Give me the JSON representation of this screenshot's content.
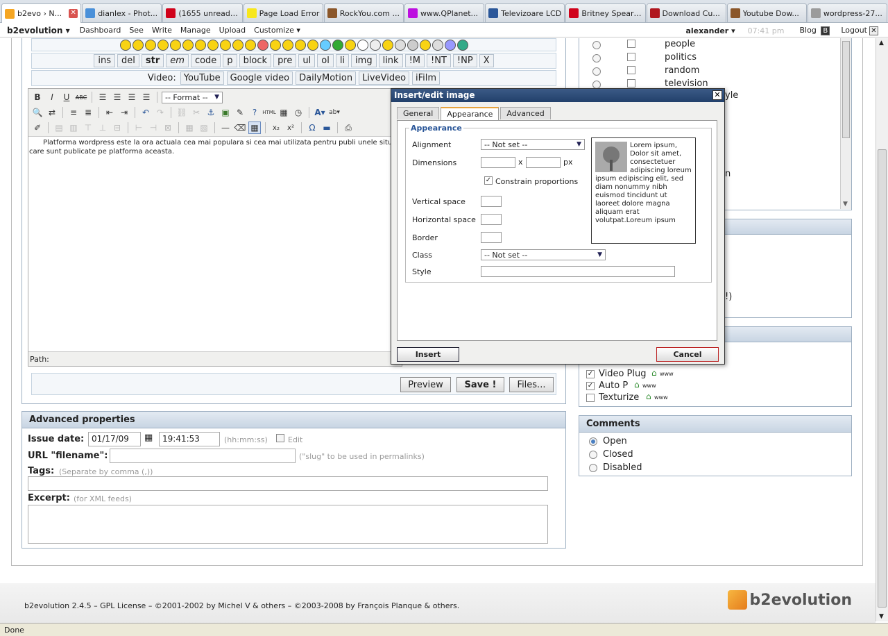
{
  "browser": {
    "tabs": [
      {
        "label": "b2evo › N...",
        "color": "#f5a623"
      },
      {
        "label": "dianlex - Phot...",
        "color": "#4a90d9"
      },
      {
        "label": "(1655 unread) ...",
        "color": "#d0021b"
      },
      {
        "label": "Page Load Error",
        "color": "#f8e71c"
      },
      {
        "label": "RockYou.com ...",
        "color": "#8b572a"
      },
      {
        "label": "www.QPlanet...",
        "color": "#bd10e0"
      },
      {
        "label": "Televizoare LCD",
        "color": "#2b5799"
      },
      {
        "label": "Britney Spears...",
        "color": "#d0021b"
      },
      {
        "label": "Download Cu...",
        "color": "#b0171f"
      },
      {
        "label": "Youtube Dow...",
        "color": "#8b572a"
      },
      {
        "label": "wordpress-27...",
        "color": "#9b9b9b"
      }
    ]
  },
  "topnav": {
    "brand": "b2evolution",
    "items": [
      "Dashboard",
      "See",
      "Write",
      "Manage",
      "Upload",
      "Customize"
    ],
    "user": "alexander",
    "time": "07:41 pm",
    "blog": "Blog",
    "logout": "Logout"
  },
  "quicktags": [
    "ins",
    "del",
    "str",
    "em",
    "code",
    "p",
    "block",
    "pre",
    "ul",
    "ol",
    "li",
    "img",
    "link",
    "!M",
    "!NT",
    "!NP",
    "X"
  ],
  "video": {
    "label": "Video:",
    "buttons": [
      "YouTube",
      "Google video",
      "DailyMotion",
      "LiveVideo",
      "iFilm"
    ]
  },
  "editor": {
    "format": "-- Format --",
    "content": "Platforma wordpress este la ora actuala cea mai populara si cea mai utilizata pentru publi unele situri care sunt publicate pe platforma aceasta.",
    "path": "Path:"
  },
  "actions": {
    "preview": "Preview",
    "save": "Save !",
    "files": "Files..."
  },
  "advanced": {
    "title": "Advanced properties",
    "issue_date_label": "Issue date:",
    "issue_date": "01/17/09",
    "issue_time": "19:41:53",
    "time_hint": "(hh:mm:ss)",
    "edit": "Edit",
    "url_label": "URL \"filename\":",
    "url_hint": "(\"slug\" to be used in permalinks)",
    "tags_label": "Tags:",
    "tags_hint": "(Separate by comma (,))",
    "excerpt_label": "Excerpt:",
    "excerpt_hint": "(for XML feeds)"
  },
  "categories": [
    "people",
    "politics",
    "random",
    "television"
  ],
  "category_partial": {
    "yle": "yle",
    "n": "n",
    "excl": "!)"
  },
  "plugins": [
    {
      "name": "Video Plug",
      "checked": true
    },
    {
      "name": "Auto P",
      "checked": true
    },
    {
      "name": "Texturize",
      "checked": false
    }
  ],
  "plugin_www": "www",
  "comments": {
    "title": "Comments",
    "options": [
      {
        "label": "Open",
        "selected": true
      },
      {
        "label": "Closed",
        "selected": false
      },
      {
        "label": "Disabled",
        "selected": false
      }
    ]
  },
  "modal": {
    "title": "Insert/edit image",
    "tabs": [
      "General",
      "Appearance",
      "Advanced"
    ],
    "legend": "Appearance",
    "alignment_label": "Alignment",
    "alignment_value": "-- Not set --",
    "dimensions_label": "Dimensions",
    "times": "x",
    "px": "px",
    "constrain": "Constrain proportions",
    "vspace_label": "Vertical space",
    "hspace_label": "Horizontal space",
    "border_label": "Border",
    "class_label": "Class",
    "class_value": "-- Not set --",
    "style_label": "Style",
    "preview_text": "Lorem ipsum, Dolor sit amet, consectetuer adipiscing loreum ipsum edipiscing elit, sed diam nonummy nibh euismod tincidunt ut laoreet dolore magna aliquam erat volutpat.Loreum ipsum",
    "insert": "Insert",
    "cancel": "Cancel"
  },
  "footer": {
    "text": "b2evolution 2.4.5 – GPL License – ©2001-2002 by Michel V & others – ©2003-2008 by François Planque & others.",
    "logo": "b2evolution"
  },
  "status": "Done"
}
